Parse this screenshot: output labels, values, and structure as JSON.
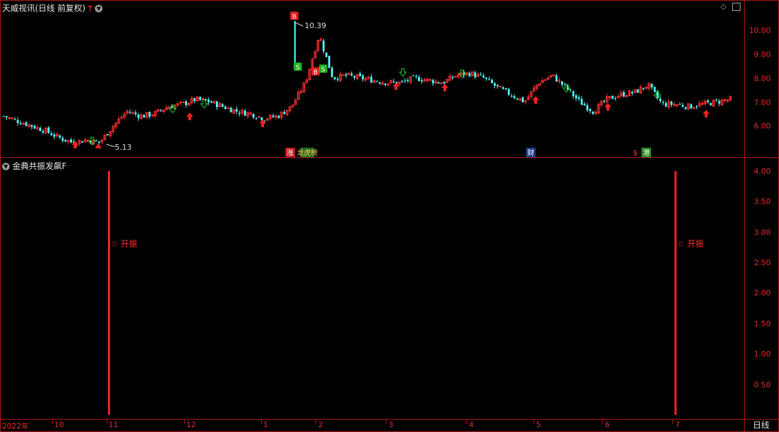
{
  "stock": {
    "title": "天威视讯(日线 前复权)",
    "signal_arrow": "up-arrow-icon",
    "menu_icon": "chevron-down-icon"
  },
  "main_chart": {
    "price_axis": [
      "10.00",
      "9.00",
      "8.00",
      "7.00",
      "6.00"
    ],
    "annotations": {
      "high_label": "10.39",
      "low_label": "5.13",
      "buy_marker": "B",
      "sell_marker": "S",
      "news_tags": [
        "涨",
        "龙虎榜",
        "财",
        "$",
        "港"
      ]
    }
  },
  "indicator": {
    "title": "金典共振发飙F",
    "axis": [
      "4.00",
      "3.50",
      "3.00",
      "2.50",
      "2.00",
      "1.50",
      "1.00",
      "0.50"
    ],
    "signal_label_1": "☆ 开振",
    "signal_label_2": "☆ 开振"
  },
  "time_axis": {
    "labels": [
      "2022年",
      "10",
      "11",
      "12",
      "1",
      "2",
      "3",
      "4",
      "5",
      "6",
      "7"
    ]
  },
  "period_button": "日线",
  "colors": {
    "up": "#ff3030",
    "down": "#54ffff",
    "frame": "#b01818"
  },
  "chart_data": {
    "type": "candlestick",
    "ylim": [
      5.0,
      10.6
    ],
    "title": "天威视讯(日线 前复权)",
    "high": 10.39,
    "low": 5.13,
    "approx_close_series": [
      6.4,
      6.2,
      6.0,
      5.8,
      5.5,
      5.3,
      5.4,
      5.3,
      6.0,
      6.6,
      6.4,
      6.5,
      6.8,
      6.9,
      7.1,
      7.0,
      6.8,
      6.6,
      6.5,
      6.3,
      6.4,
      6.8,
      7.8,
      9.8,
      8.0,
      8.1,
      8.0,
      7.9,
      7.8,
      7.8,
      8.0,
      7.9,
      7.8,
      8.1,
      8.2,
      8.0,
      7.6,
      7.3,
      7.0,
      7.8,
      8.1,
      7.6,
      7.0,
      6.6,
      7.1,
      7.3,
      7.4,
      7.7,
      6.9,
      6.9,
      6.8,
      6.9,
      7.0,
      7.1
    ],
    "indicator_signals": [
      {
        "date_label": "11",
        "value": 4.0,
        "label": "☆ 开振"
      },
      {
        "date_label": "7",
        "value": 4.0,
        "label": "☆ 开振"
      }
    ]
  }
}
